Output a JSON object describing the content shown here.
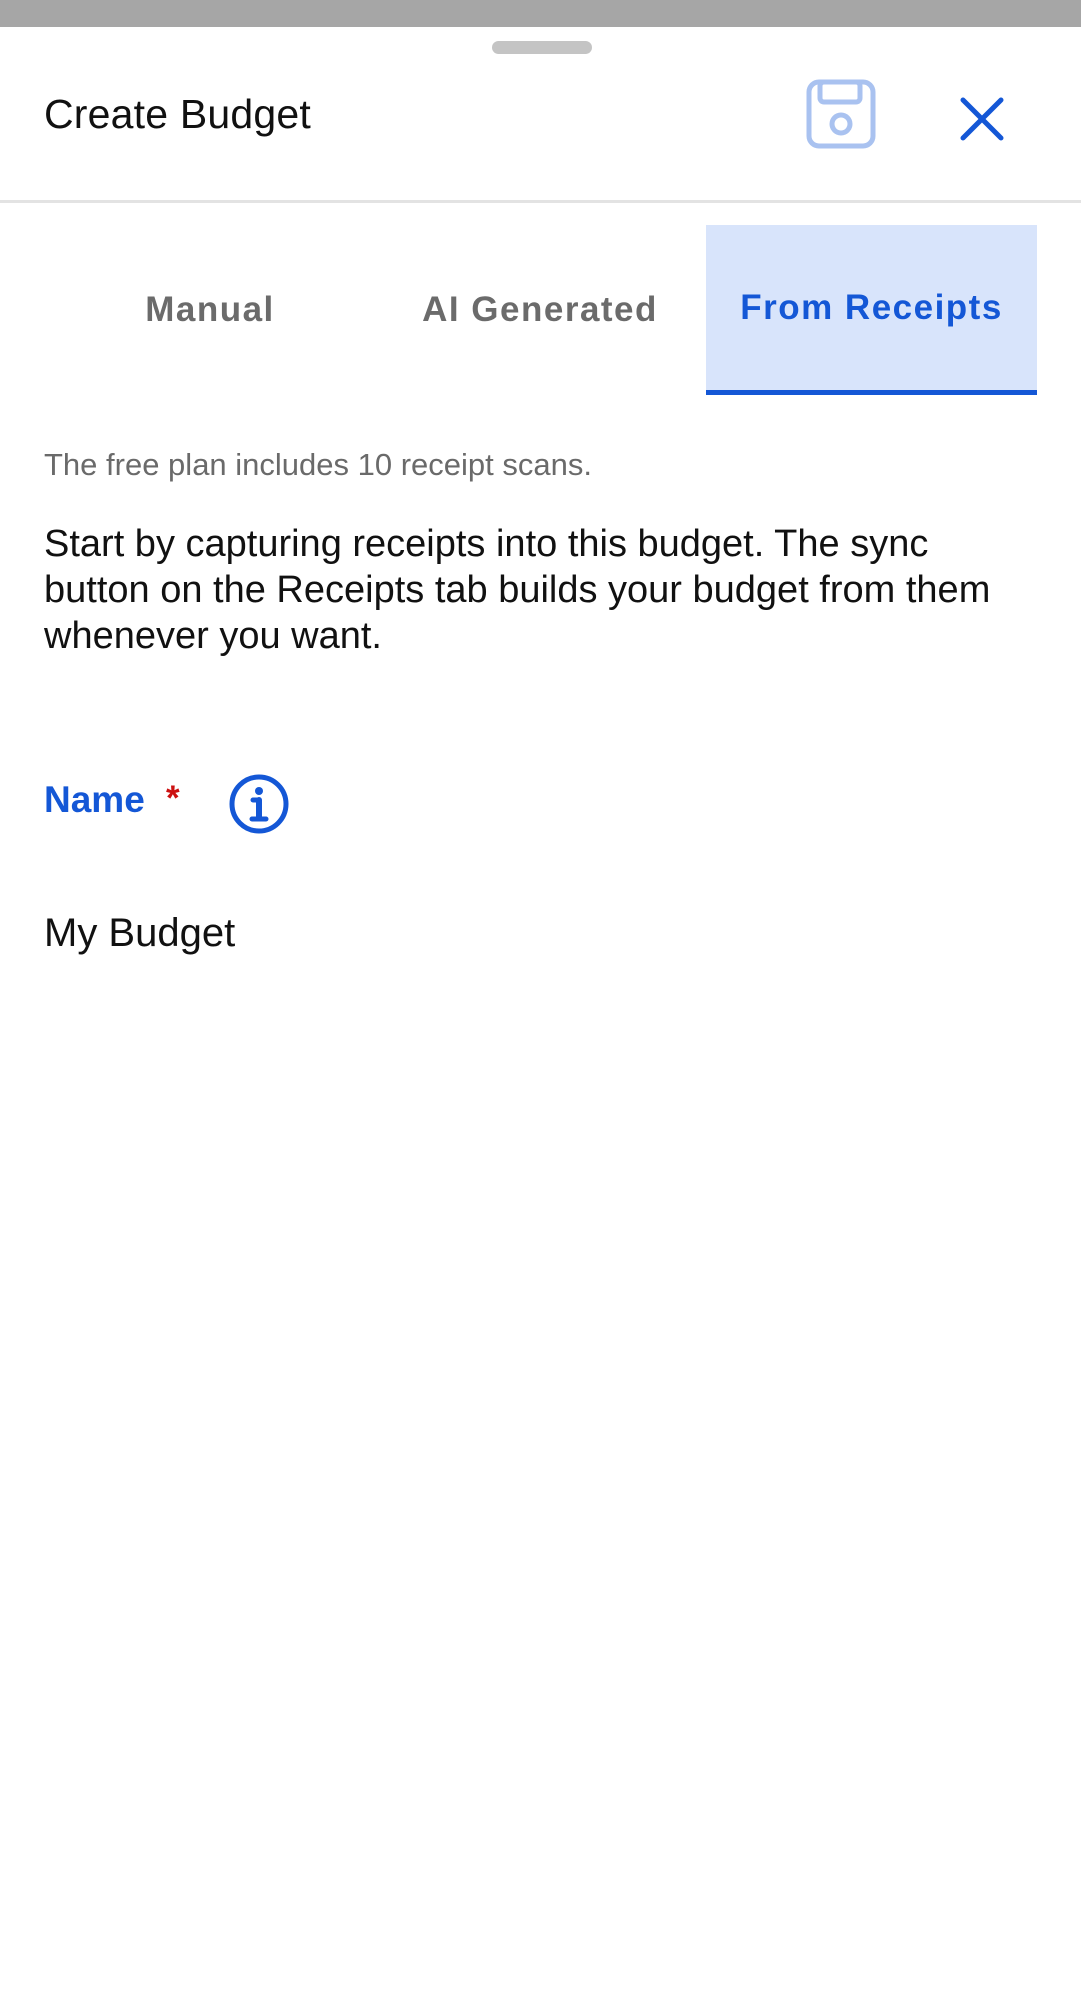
{
  "header": {
    "title": "Create Budget",
    "save_icon": "floppy-disk-icon",
    "close_icon": "close-x-icon"
  },
  "tabs": [
    {
      "label": "Manual",
      "selected": false
    },
    {
      "label": "AI Generated",
      "selected": false
    },
    {
      "label": "From Receipts",
      "selected": true
    }
  ],
  "content": {
    "plan_note": "The free plan includes 10 receipt scans.",
    "description": "Start by capturing receipts into this budget. The sync button on the Receipts tab builds your budget from them whenever you want.",
    "name_field": {
      "label": "Name",
      "required_marker": "*",
      "info_icon": "info-circle-icon",
      "value": "My Budget"
    }
  },
  "colors": {
    "accent": "#1457d6",
    "selected_tab_bg": "#d8e4fb",
    "required": "#cc1111",
    "save_icon_disabled": "#a9c2f0"
  }
}
